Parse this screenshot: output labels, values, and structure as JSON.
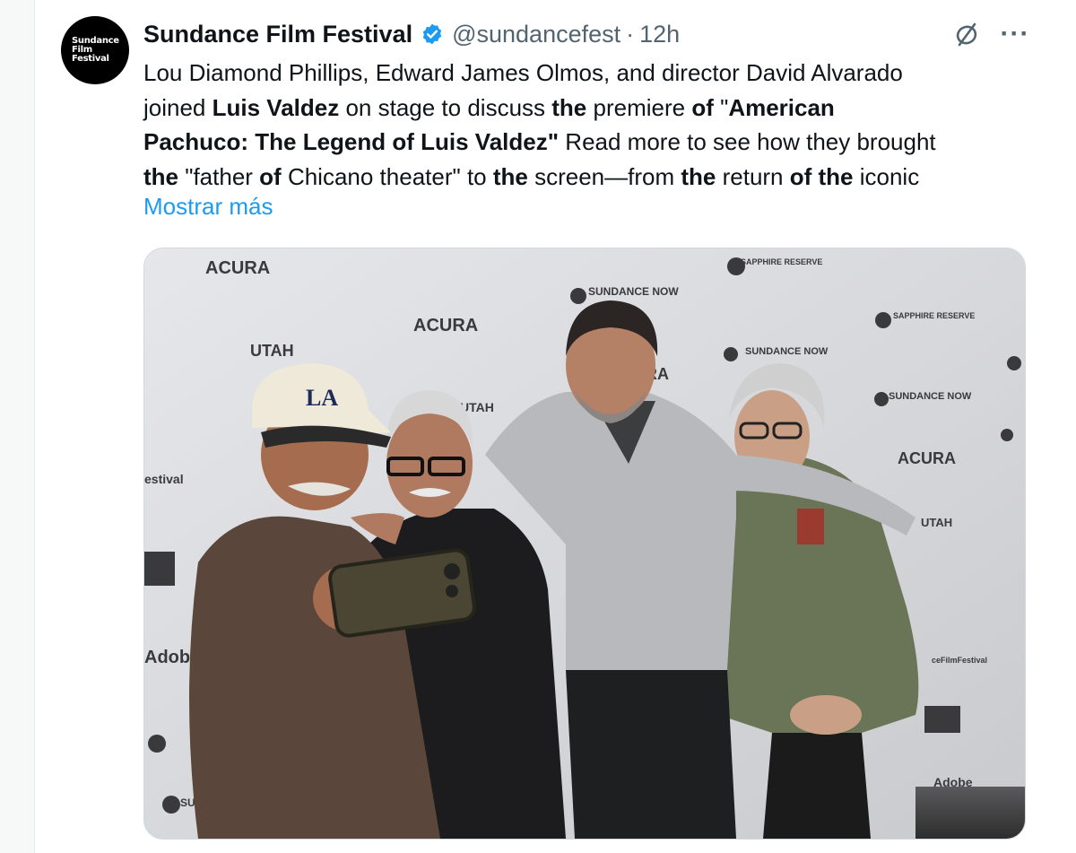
{
  "tweet": {
    "author_name": "Sundance Film Festival",
    "handle": "@sundancefest",
    "separator": "·",
    "time": "12h",
    "avatar_lines": [
      "Sundance",
      "Film",
      "Festival"
    ],
    "text_lines": [
      [
        {
          "t": "Lou Diamond Phillips, Edward James Olmos, and director David Alvarado",
          "b": false
        }
      ],
      [
        {
          "t": "joined ",
          "b": false
        },
        {
          "t": "Luis Valdez",
          "b": true
        },
        {
          "t": " on stage to discuss ",
          "b": false
        },
        {
          "t": "the",
          "b": true
        },
        {
          "t": " premiere ",
          "b": false
        },
        {
          "t": "of",
          "b": true
        },
        {
          "t": " \"",
          "b": false
        },
        {
          "t": "American",
          "b": true
        }
      ],
      [
        {
          "t": "Pachuco: The Legend of Luis Valdez\"",
          "b": true
        },
        {
          "t": " Read more to see how they brought",
          "b": false
        }
      ],
      [
        {
          "t": "the",
          "b": true
        },
        {
          "t": " \"father ",
          "b": false
        },
        {
          "t": "of",
          "b": true
        },
        {
          "t": " Chicano theater\" to ",
          "b": false
        },
        {
          "t": "the",
          "b": true
        },
        {
          "t": " screen—from ",
          "b": false
        },
        {
          "t": "the",
          "b": true
        },
        {
          "t": " return ",
          "b": false
        },
        {
          "t": "of the",
          "b": true
        },
        {
          "t": " iconic",
          "b": false
        }
      ]
    ],
    "show_more_label": "Mostrar más",
    "more_label": "···"
  },
  "photo": {
    "backdrop_logos": [
      "ACURA",
      "SUNDANCE NOW",
      "SAPPHIRE RESERVE",
      "UTAH",
      "Adobe",
      "estival",
      "ceFilmFestival"
    ],
    "cap_logo": "LA"
  },
  "colors": {
    "accent": "#1d9bf0",
    "text": "#0f1419",
    "muted": "#536471",
    "border": "#cfd9de"
  }
}
